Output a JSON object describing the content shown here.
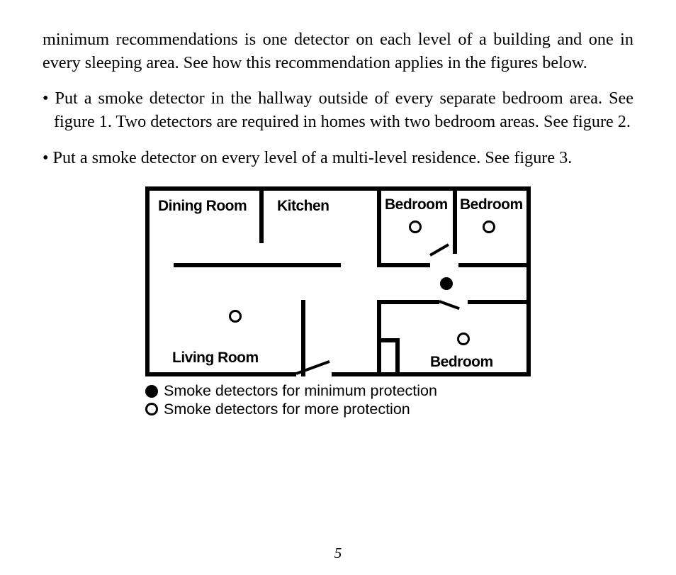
{
  "paragraphs": {
    "intro": "minimum recommendations is one detector on each level of a building and one in every sleeping area. See how this recommendation applies in the figures below.",
    "bullet1": "• Put a smoke detector in the hallway outside of every separate bedroom area. See figure 1. Two detectors are required in homes with two bedroom areas. See figure 2.",
    "bullet2": "• Put a smoke detector on every level of a multi-level residence. See figure 3."
  },
  "floorplan": {
    "rooms": {
      "dining": "Dining Room",
      "kitchen": "Kitchen",
      "bedroomTL": "Bedroom",
      "bedroomTR": "Bedroom",
      "living": "Living Room",
      "bedroomBR": "Bedroom"
    },
    "detectors": [
      {
        "type": "open",
        "room": "bedroomTL"
      },
      {
        "type": "open",
        "room": "bedroomTR"
      },
      {
        "type": "fill",
        "room": "hallway"
      },
      {
        "type": "open",
        "room": "living"
      },
      {
        "type": "open",
        "room": "bedroomBR"
      }
    ]
  },
  "legend": {
    "min": "Smoke detectors for minimum protection",
    "more": "Smoke detectors for more protection"
  },
  "pageNumber": "5"
}
